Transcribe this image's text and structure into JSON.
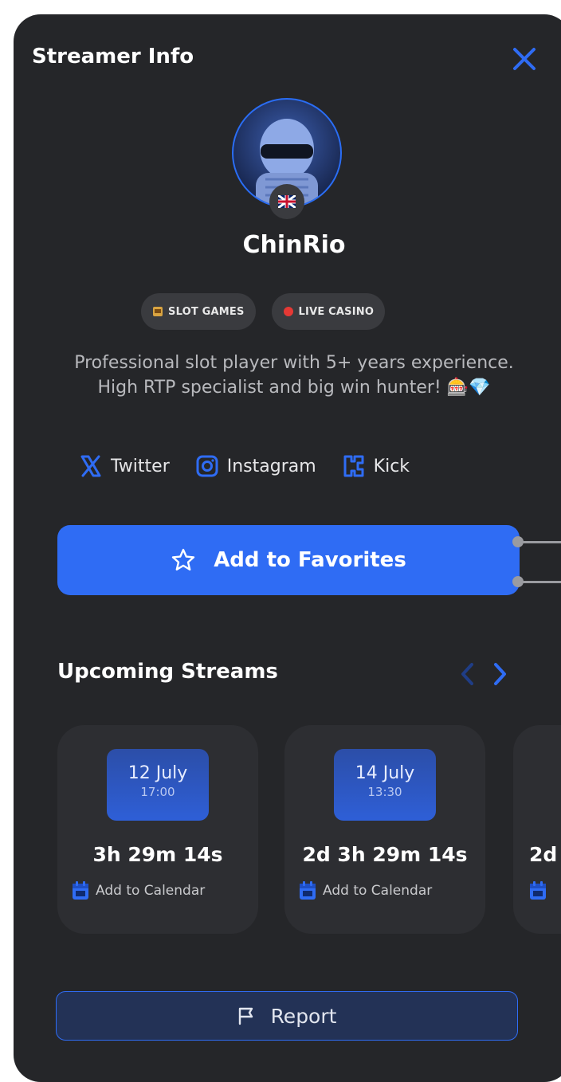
{
  "header": {
    "title": "Streamer Info",
    "close_icon": "close-icon"
  },
  "profile": {
    "name": "ChinRio",
    "flag_icon": "uk-flag-icon",
    "tags": [
      {
        "label": "SLOT GAMES",
        "icon": "slot-machine-icon"
      },
      {
        "label": "LIVE CASINO",
        "icon": "red-dot-icon"
      }
    ],
    "description": "Professional slot player with 5+ years experience. High RTP specialist and big win hunter! 🎰💎"
  },
  "socials": [
    {
      "label": "Twitter",
      "icon": "x-icon"
    },
    {
      "label": "Instagram",
      "icon": "instagram-icon"
    },
    {
      "label": "Kick",
      "icon": "kick-icon"
    }
  ],
  "favorite": {
    "label": "Add to Favorites",
    "icon": "star-icon"
  },
  "upcoming": {
    "title": "Upcoming Streams",
    "streams": [
      {
        "date": "12 July",
        "time": "17:00",
        "countdown": "3h 29m 14s",
        "calendar_label": "Add to Calendar"
      },
      {
        "date": "14 July",
        "time": "13:30",
        "countdown": "2d 3h 29m 14s",
        "calendar_label": "Add to Calendar"
      },
      {
        "date": "",
        "time": "",
        "countdown": "2d",
        "calendar_label": ""
      }
    ]
  },
  "report": {
    "label": "Report",
    "icon": "flag-icon"
  },
  "colors": {
    "accent": "#2f6cf4",
    "panel": "#252629",
    "card": "#2d2e32"
  }
}
